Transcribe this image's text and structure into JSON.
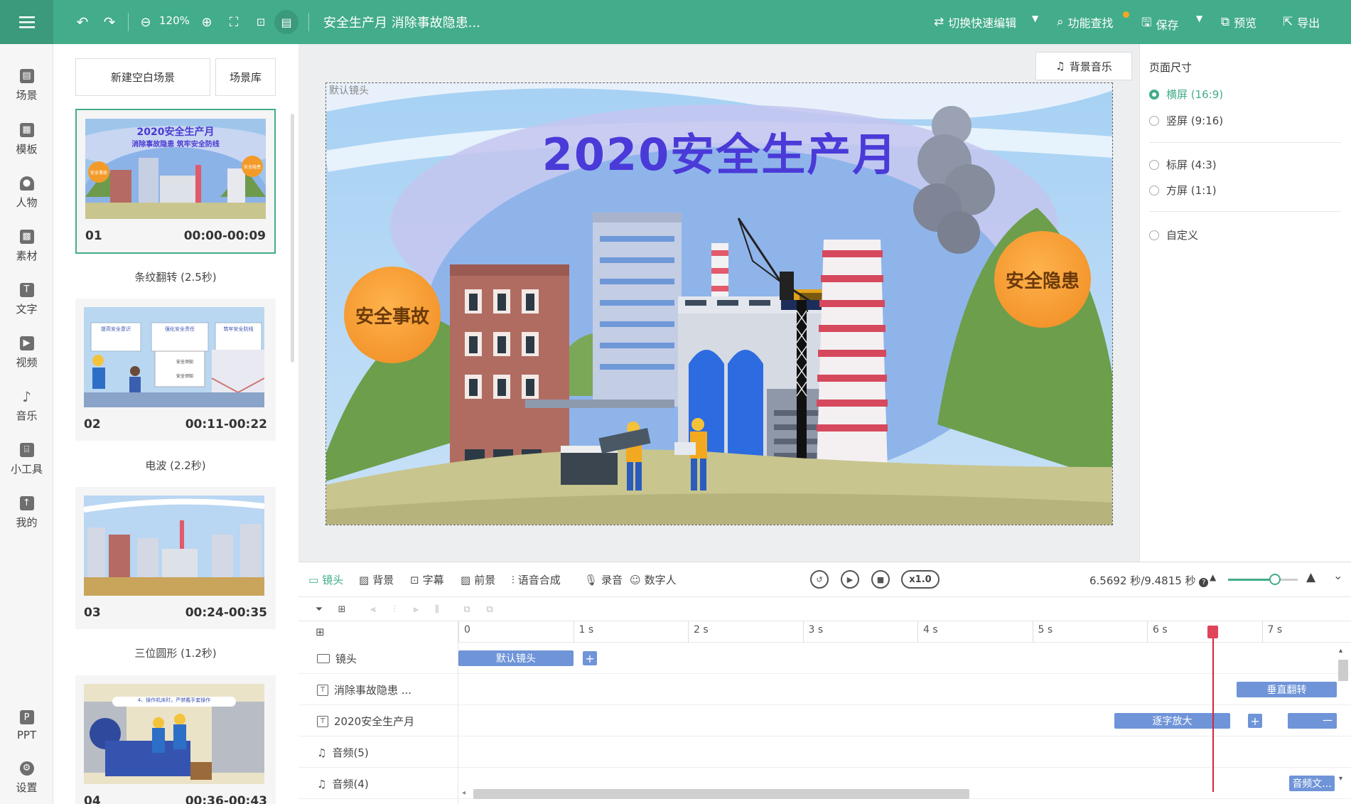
{
  "topbar": {
    "zoom": "120%",
    "title": "安全生产月 消除事故隐患...",
    "switch_label": "切换快速编辑",
    "find_label": "功能查找",
    "save_label": "保存",
    "preview_label": "预览",
    "export_label": "导出"
  },
  "nav": [
    {
      "label": "场景",
      "icon": "scene-icon"
    },
    {
      "label": "模板",
      "icon": "template-icon"
    },
    {
      "label": "人物",
      "icon": "person-icon"
    },
    {
      "label": "素材",
      "icon": "material-icon"
    },
    {
      "label": "文字",
      "icon": "text-icon"
    },
    {
      "label": "视频",
      "icon": "video-icon"
    },
    {
      "label": "音乐",
      "icon": "music-icon"
    },
    {
      "label": "小工具",
      "icon": "toolbox-icon"
    },
    {
      "label": "我的",
      "icon": "upload-icon"
    }
  ],
  "nav_bottom": [
    {
      "label": "PPT",
      "icon": "ppt-icon"
    },
    {
      "label": "设置",
      "icon": "settings-icon"
    }
  ],
  "scene_panel": {
    "new_blank": "新建空白场景",
    "library": "场景库",
    "scenes": [
      {
        "num": "01",
        "time": "00:00-00:09",
        "title1": "2020安全生产月",
        "title2": "消除事故隐患 筑牢安全防线",
        "badge1": "安全事故",
        "badge2": "安全隐患"
      },
      {
        "num": "02",
        "time": "00:11-00:22",
        "panels": [
          "提高安全意识",
          "强化安全责任",
          "筑牢安全防线"
        ],
        "board1": "安全须知",
        "board2": "安全须知"
      },
      {
        "num": "03",
        "time": "00:24-00:35"
      },
      {
        "num": "04",
        "time": "00:36-00:43",
        "banner": "4、操作机床时，严禁戴手套操作"
      }
    ],
    "transitions": [
      "条纹翻转 (2.5秒)",
      "电波 (2.2秒)",
      "三位圆形 (1.2秒)"
    ]
  },
  "canvas": {
    "bgm_label": "背景音乐",
    "lens_label": "默认镜头",
    "stage_title": "2020安全生产月",
    "badge_left": "安全事故",
    "badge_right": "安全隐患"
  },
  "page_size": {
    "title": "页面尺寸",
    "options": [
      {
        "label": "横屏 (16:9)",
        "selected": true
      },
      {
        "label": "竖屏 (9:16)",
        "selected": false
      },
      {
        "label": "标屏 (4:3)",
        "selected": false
      },
      {
        "label": "方屏 (1:1)",
        "selected": false
      },
      {
        "label": "自定义",
        "selected": false
      }
    ]
  },
  "timeline": {
    "tabs": [
      "镜头",
      "背景",
      "字幕",
      "前景",
      "语音合成",
      "录音",
      "数字人"
    ],
    "active_tab": "镜头",
    "speed": "x1.0",
    "time_readout": "6.5692 秒/9.4815 秒",
    "playhead_seconds": 6.5692,
    "total_seconds": 9.4815,
    "ruler": [
      "0",
      "1 s",
      "2 s",
      "3 s",
      "4 s",
      "5 s",
      "6 s",
      "7 s"
    ],
    "tracks": [
      {
        "name": "镜头",
        "icon": "camera-icon"
      },
      {
        "name": "消除事故隐患 ...",
        "icon": "text-track-icon"
      },
      {
        "name": "2020安全生产月",
        "icon": "text-track-icon"
      },
      {
        "name": "音频(5)",
        "icon": "music-icon"
      },
      {
        "name": "音频(4)",
        "icon": "music-icon"
      }
    ],
    "clips": {
      "lens": "默认镜头",
      "flip": "垂直翻转",
      "zoom_in": "逐字放大",
      "cut": "一",
      "audio": "音频文..."
    },
    "colors": {
      "accent": "#43ac8a",
      "clip": "#6f94d8",
      "playhead": "#d0283b"
    }
  }
}
